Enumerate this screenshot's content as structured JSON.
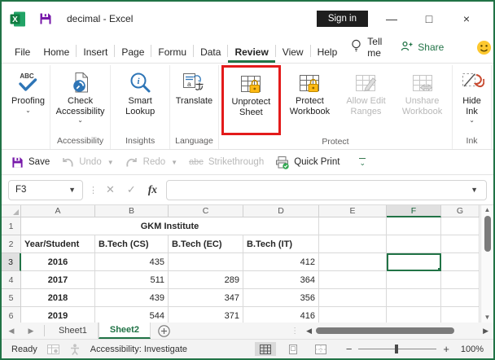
{
  "window": {
    "title": "decimal  -  Excel",
    "sign_in_label": "Sign in"
  },
  "menubar": {
    "tabs": [
      {
        "label": "File"
      },
      {
        "label": "Home"
      },
      {
        "label": "Insert"
      },
      {
        "label": "Page"
      },
      {
        "label": "Formu"
      },
      {
        "label": "Data"
      },
      {
        "label": "Review",
        "active": true
      },
      {
        "label": "View"
      },
      {
        "label": "Help"
      }
    ],
    "tell_me_label": "Tell me",
    "share_label": "Share"
  },
  "ribbon": {
    "groups": [
      {
        "label": "",
        "buttons": [
          {
            "label": "Proofing",
            "icon": "spellcheck-icon",
            "chevron": true
          }
        ]
      },
      {
        "label": "Accessibility",
        "buttons": [
          {
            "label": "Check Accessibility",
            "icon": "accessibility-check-icon",
            "chevron": true
          }
        ]
      },
      {
        "label": "Insights",
        "buttons": [
          {
            "label": "Smart Lookup",
            "icon": "smart-lookup-icon"
          }
        ]
      },
      {
        "label": "Language",
        "buttons": [
          {
            "label": "Translate",
            "icon": "translate-icon"
          }
        ]
      },
      {
        "label": "Protect",
        "buttons": [
          {
            "label": "Unprotect Sheet",
            "icon": "unprotect-sheet-icon",
            "highlighted": true
          },
          {
            "label": "Protect Workbook",
            "icon": "protect-workbook-icon"
          },
          {
            "label": "Allow Edit Ranges",
            "icon": "allow-edit-ranges-icon",
            "disabled": true
          },
          {
            "label": "Unshare Workbook",
            "icon": "unshare-workbook-icon",
            "disabled": true
          }
        ]
      },
      {
        "label": "Ink",
        "buttons": [
          {
            "label": "Hide Ink",
            "icon": "hide-ink-icon",
            "chevron": true
          }
        ]
      }
    ]
  },
  "quick_access": {
    "items": [
      {
        "label": "Save",
        "icon": "save-icon"
      },
      {
        "label": "Undo",
        "icon": "undo-icon",
        "disabled": true,
        "chevron": true
      },
      {
        "label": "Redo",
        "icon": "redo-icon",
        "disabled": true,
        "chevron": true
      },
      {
        "label": "Strikethrough",
        "icon": "strikethrough-icon",
        "icon_text": "abc",
        "disabled": true
      },
      {
        "label": "Quick Print",
        "icon": "quick-print-icon"
      }
    ]
  },
  "formula_bar": {
    "name_box_value": "F3",
    "fx_label": "fx",
    "formula_value": ""
  },
  "sheet": {
    "columns": [
      "A",
      "B",
      "C",
      "D",
      "E",
      "F",
      "G"
    ],
    "selected_column": "F",
    "selected_row": 3,
    "selected_cell": "F3",
    "rows": [
      {
        "num": "1",
        "merged_text": "GKM Institute",
        "merge_cols": 4,
        "values": [
          "",
          "",
          ""
        ]
      },
      {
        "num": "2",
        "values": [
          "Year/Student",
          "B.Tech (CS)",
          "B.Tech (EC)",
          "B.Tech (IT)",
          "",
          "",
          ""
        ]
      },
      {
        "num": "3",
        "values": [
          "2016",
          "435",
          "",
          "412",
          "",
          "",
          ""
        ]
      },
      {
        "num": "4",
        "values": [
          "2017",
          "511",
          "289",
          "364",
          "",
          "",
          ""
        ]
      },
      {
        "num": "5",
        "values": [
          "2018",
          "439",
          "347",
          "356",
          "",
          "",
          ""
        ]
      },
      {
        "num": "6",
        "values": [
          "2019",
          "544",
          "371",
          "416",
          "",
          "",
          ""
        ]
      }
    ]
  },
  "sheet_tabs": {
    "tabs": [
      {
        "label": "Sheet1"
      },
      {
        "label": "Sheet2",
        "active": true
      }
    ]
  },
  "status_bar": {
    "ready_label": "Ready",
    "accessibility_label": "Accessibility: Investigate",
    "zoom_level": "100%"
  },
  "colors": {
    "accent_green": "#217346",
    "highlight_red": "#e31b1b",
    "save_purple": "#7719aa",
    "lock_gold": "#fdb913",
    "smiley_yellow": "#fdc82f"
  }
}
